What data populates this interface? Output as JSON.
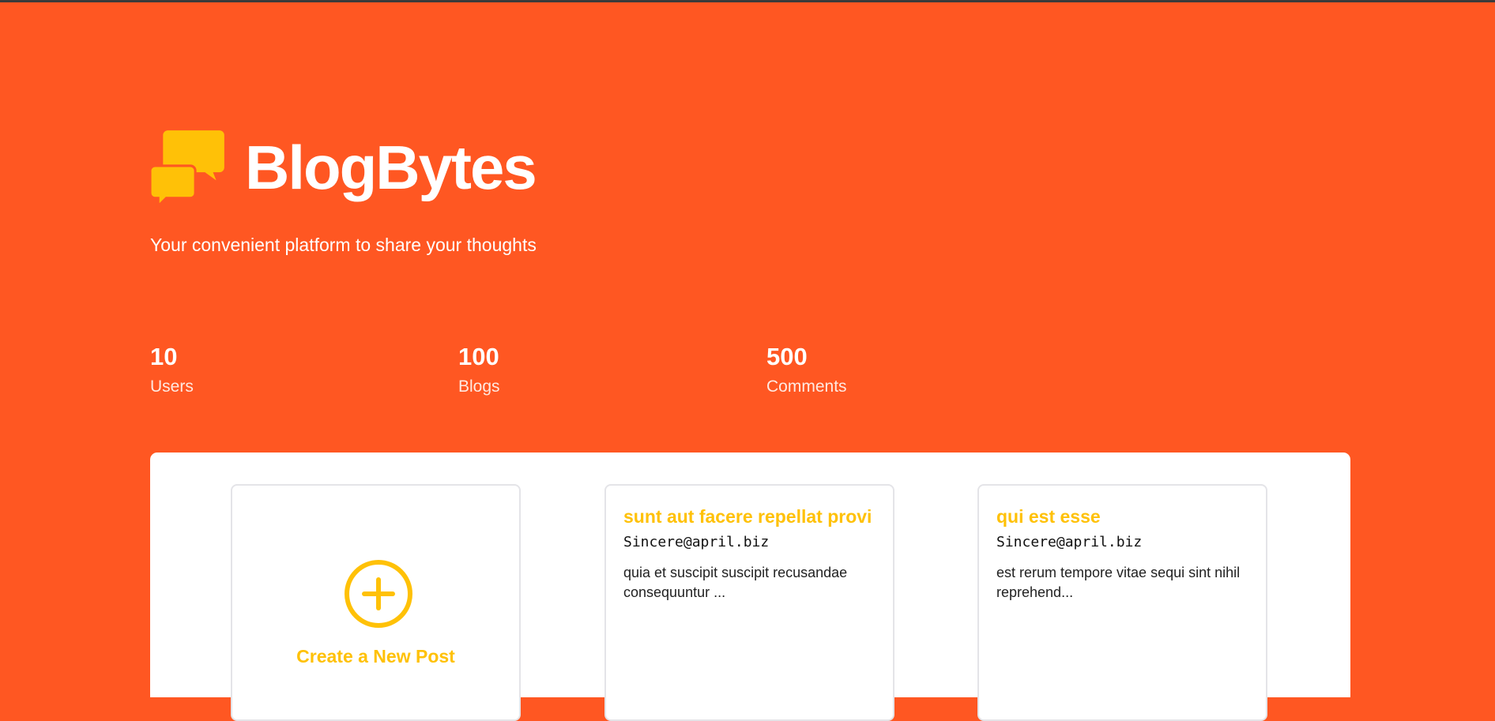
{
  "brand": {
    "title": "BlogBytes",
    "tagline": "Your convenient platform to share your thoughts",
    "logo_icon": "chat-bubbles-icon"
  },
  "stats": [
    {
      "value": "10",
      "label": "Users"
    },
    {
      "value": "100",
      "label": "Blogs"
    },
    {
      "value": "500",
      "label": "Comments"
    }
  ],
  "create_card": {
    "label": "Create a New Post",
    "icon": "plus-circle-icon"
  },
  "posts": [
    {
      "title": "sunt aut facere repellat provi",
      "author": "Sincere@april.biz",
      "excerpt": "quia et suscipit suscipit recusandae consequuntur ..."
    },
    {
      "title": "qui est esse",
      "author": "Sincere@april.biz",
      "excerpt": "est rerum tempore vitae sequi sint nihil reprehend..."
    }
  ],
  "colors": {
    "background": "#FF5722",
    "accent": "#FFC107",
    "panel": "#FFFFFF"
  }
}
